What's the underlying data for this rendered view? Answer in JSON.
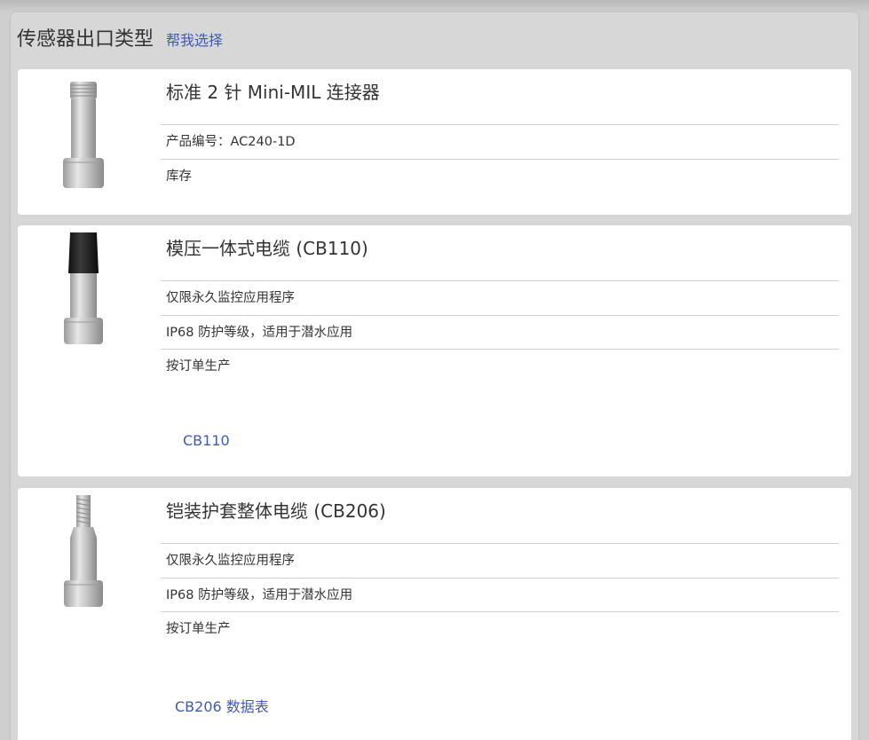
{
  "header": {
    "title": "传感器出口类型",
    "help_link": "帮我选择"
  },
  "cards": [
    {
      "title": "标准 2 针 Mini-MIL 连接器",
      "rows": [
        "产品编号：AC240-1D",
        "库存"
      ]
    },
    {
      "title": "模压一体式电缆 (CB110)",
      "rows": [
        "仅限永久监控应用程序",
        "IP68 防护等级，适用于潜水应用",
        "按订单生产"
      ],
      "link": "CB110"
    },
    {
      "title": "铠装护套整体电缆 (CB206)",
      "rows": [
        "仅限永久监控应用程序",
        "IP68 防护等级，适用于潜水应用",
        "按订单生产"
      ],
      "link": "CB206 数据表"
    }
  ],
  "icons": [
    "connector-sensor-icon",
    "molded-cable-sensor-icon",
    "armored-cable-sensor-icon"
  ]
}
